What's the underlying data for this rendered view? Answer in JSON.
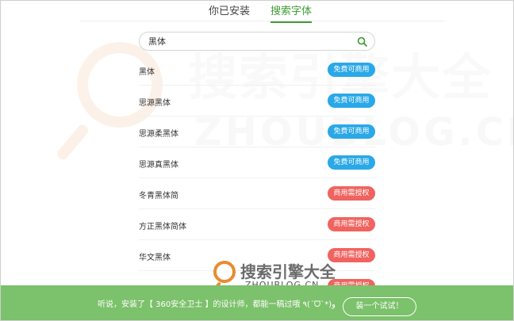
{
  "tabs": [
    {
      "label": "你已安装",
      "active": false
    },
    {
      "label": "搜索字体",
      "active": true
    }
  ],
  "search": {
    "value": "黑体",
    "icon": "search-icon"
  },
  "fonts": [
    {
      "name": "黑体",
      "license": "免费可商用",
      "license_type": "free"
    },
    {
      "name": "思源黑体",
      "license": "免费可商用",
      "license_type": "free"
    },
    {
      "name": "思源柔黑体",
      "license": "免费可商用",
      "license_type": "free"
    },
    {
      "name": "思源真黑体",
      "license": "免费可商用",
      "license_type": "free"
    },
    {
      "name": "冬青黑体简",
      "license": "商用需授权",
      "license_type": "paid"
    },
    {
      "name": "方正黑体简体",
      "license": "商用需授权",
      "license_type": "paid"
    },
    {
      "name": "华文黑体",
      "license": "商用需授权",
      "license_type": "paid"
    },
    {
      "name": "",
      "license": "商用需授权",
      "license_type": "paid"
    }
  ],
  "watermark": {
    "cn": "搜索引擎大全",
    "en": "ZHOUBLOG.CN"
  },
  "banner": {
    "message": "听说，安装了【 360安全卫士 】的设计师，都能一稿过哦 ٩(ˊᗜˋ*)و",
    "button": "装一个试试！"
  },
  "colors": {
    "accent": "#3f9c35",
    "free_badge": "#2aa8e8",
    "paid_badge": "#f0635f",
    "banner_bg": "#7cc16b"
  }
}
